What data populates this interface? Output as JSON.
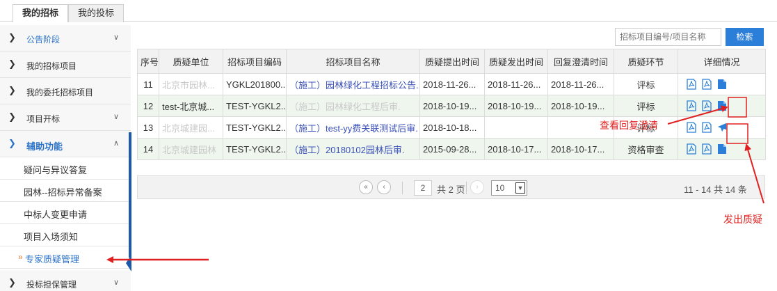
{
  "tabs": [
    {
      "label": "我的招标",
      "active": true
    },
    {
      "label": "我的投标",
      "active": false
    }
  ],
  "sidebar": {
    "items": [
      {
        "label": "公告阶段",
        "expandable": true,
        "state": "down"
      },
      {
        "label": "我的招标项目"
      },
      {
        "label": "我的委托招标项目"
      },
      {
        "label": "项目开标",
        "expandable": true,
        "state": "down"
      },
      {
        "label": "辅助功能",
        "expandable": true,
        "state": "up"
      }
    ],
    "sub_items": [
      {
        "label": "疑问与异议答复"
      },
      {
        "label": "园林--招标异常备案"
      },
      {
        "label": "中标人变更申请"
      },
      {
        "label": "项目入场须知"
      },
      {
        "label": "专家质疑管理",
        "active": true
      }
    ],
    "bottom_item": {
      "label": "投标担保管理",
      "expandable": true
    }
  },
  "search": {
    "placeholder": "招标项目编号/项目名称",
    "button_label": "检索"
  },
  "table": {
    "headers": [
      "序号",
      "质疑单位",
      "招标项目编码",
      "招标项目名称",
      "质疑提出时间",
      "质疑发出时间",
      "回复澄清时间",
      "质疑环节",
      "详细情况"
    ],
    "rows": [
      {
        "no": "11",
        "unit": "北京市园林...",
        "code": "YGKL201800...",
        "name": "（施工）园林绿化工程招标公告...",
        "raised": "2018-11-26...",
        "sent": "2018-11-26...",
        "replied": "2018-11-26...",
        "stage": "评标"
      },
      {
        "no": "12",
        "unit": "test-北京城...",
        "code": "TEST-YGKL2...",
        "name": "（施工）园林绿化工程后审.",
        "raised": "2018-10-19...",
        "sent": "2018-10-19...",
        "replied": "2018-10-19...",
        "stage": "评标"
      },
      {
        "no": "13",
        "unit": "北京城建园...",
        "code": "TEST-YGKL2...",
        "name": "（施工）test-yy费关联测试后审.",
        "raised": "2018-10-18...",
        "sent": "",
        "replied": "",
        "stage": "评标"
      },
      {
        "no": "14",
        "unit": "北京城建园林",
        "code": "TEST-YGKL2...",
        "name": "（施工）20180102园林后审.",
        "raised": "2015-09-28...",
        "sent": "2018-10-17...",
        "replied": "2018-10-17...",
        "stage": "资格审查"
      }
    ]
  },
  "pager": {
    "current_page": "2",
    "total_pages_text": "共 2 页",
    "page_size": "10",
    "range_text": "11 - 14  共 14 条"
  },
  "annotations": {
    "view_reply": "查看回复澄清",
    "send_query": "发出质疑"
  },
  "colors": {
    "accent": "#2b7fd8",
    "annotation": "#e02020",
    "active_link": "#2b73c9"
  }
}
